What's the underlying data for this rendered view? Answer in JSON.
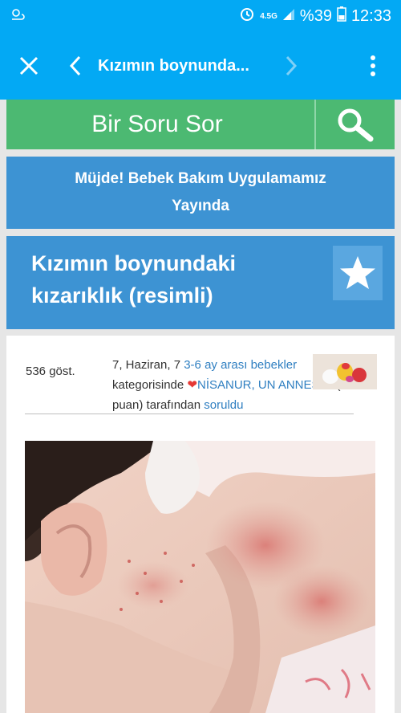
{
  "status_bar": {
    "network_type": "4.5G",
    "battery_percent": "%39",
    "time": "12:33"
  },
  "app_bar": {
    "title": "Kızımın boynunda..."
  },
  "ask": {
    "label": "Bir Soru Sor"
  },
  "banner": {
    "text": "Müjde! Bebek Bakım Uygulamamız Yayında"
  },
  "question": {
    "title": "Kızımın boynundaki kızarıklık (resimli)",
    "views": "536 göst.",
    "date": "7, Haziran, 7",
    "category_link": "3-6 ay arası bebekler",
    "category_suffix": "kategorisinde",
    "author_link": "NİSANUR, UN ANNESİ",
    "points": "(201 puan) tarafından",
    "asked_link": "soruldu"
  },
  "colors": {
    "app_bar": "#03a9f4",
    "ask_bar": "#4cb972",
    "banner": "#3d93d3",
    "link": "#2f7fc1",
    "heart": "#e53935"
  },
  "icons": {
    "close": "close-icon",
    "back": "chevron-left-icon",
    "forward": "chevron-right-icon",
    "menu": "more-vert-icon",
    "search": "search-icon",
    "favorite": "star-icon"
  }
}
